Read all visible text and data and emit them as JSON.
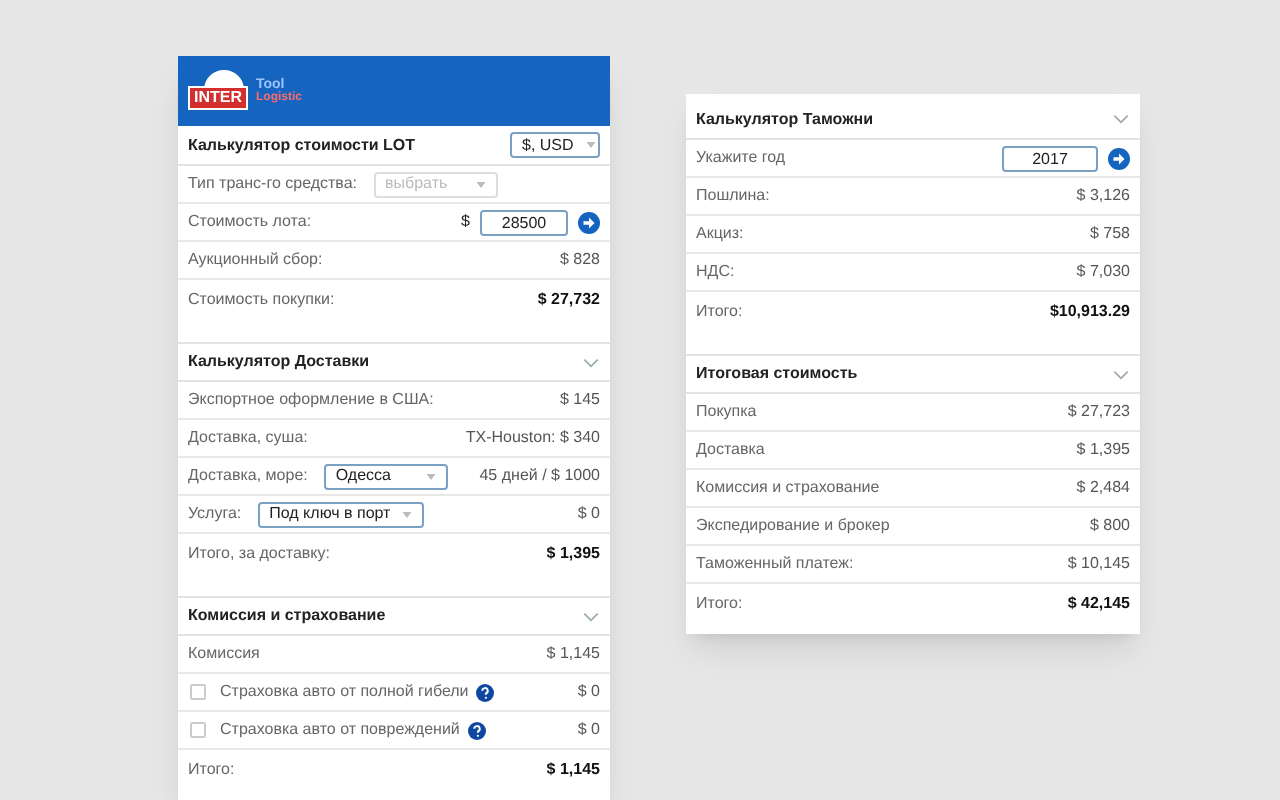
{
  "panels": [
    {
      "logo": {
        "badge": "INTER",
        "word_1": "Tool",
        "word_2": "Logistic"
      },
      "sections": [
        {
          "title": "Калькулятор стоимости LOT",
          "header_select": {
            "value": "$, USD",
            "disabled": false
          },
          "rows": [
            {
              "kind": "select",
              "label": "Тип транс-го средства:",
              "select": {
                "value": "выбрать",
                "disabled": true
              }
            },
            {
              "kind": "input",
              "label": "Стоимость лота:",
              "prefix": "$",
              "input": "28500"
            },
            {
              "kind": "text",
              "label": "Аукционный сбор:",
              "value": "$ 828"
            },
            {
              "kind": "total",
              "label": "Стоимость покупки:",
              "value": "$ 27,732"
            }
          ]
        },
        {
          "title": "Калькулятор Доставки",
          "rows": [
            {
              "kind": "text",
              "label": "Экспортное оформление в США:",
              "value": "$ 145"
            },
            {
              "kind": "text",
              "label": "Доставка, суша:",
              "value": "TX-Houston: $ 340"
            },
            {
              "kind": "select",
              "label": "Доставка, море:",
              "select": {
                "value": "Одесса",
                "disabled": false
              },
              "value": "45 дней / $ 1000"
            },
            {
              "kind": "select",
              "label": "Услуга:",
              "select": {
                "value": "Под ключ в порт",
                "disabled": false
              },
              "value": "$ 0"
            },
            {
              "kind": "total",
              "label": "Итого, за доставку:",
              "value": "$ 1,395"
            }
          ]
        },
        {
          "title": "Комиссия и страхование",
          "rows": [
            {
              "kind": "text",
              "label": "Комиссия",
              "value": "$ 1,145"
            },
            {
              "kind": "checkbox",
              "label": "Страховка авто от полной гибели",
              "checked": false,
              "value": "$ 0"
            },
            {
              "kind": "checkbox",
              "label": "Страховка авто от повреждений",
              "checked": false,
              "value": "$ 0"
            },
            {
              "kind": "total",
              "label": "Итого:",
              "value": "$ 1,145"
            }
          ]
        }
      ]
    },
    {
      "sections": [
        {
          "title": "Калькулятор Таможни",
          "rows": [
            {
              "kind": "spinner",
              "label": "Укажите год",
              "input": "2017"
            },
            {
              "kind": "text",
              "label": "Пошлина:",
              "value": "$ 3,126"
            },
            {
              "kind": "text",
              "label": "Акциз:",
              "value": "$ 758"
            },
            {
              "kind": "text",
              "label": "НДС:",
              "value": "$ 7,030"
            },
            {
              "kind": "total",
              "label": "Итого:",
              "value": "$10,913.29"
            }
          ]
        },
        {
          "title": "Итоговая стоимость",
          "rows": [
            {
              "kind": "text",
              "label": "Покупка",
              "value": "$ 27,723"
            },
            {
              "kind": "text",
              "label": "Доставка",
              "value": "$ 1,395"
            },
            {
              "kind": "text",
              "label": "Комиссия и страхование",
              "value": "$ 2,484"
            },
            {
              "kind": "text",
              "label": "Экспедирование и брокер",
              "value": "$ 800"
            },
            {
              "kind": "text",
              "label": "Таможенный платеж:",
              "value": "$ 10,145"
            },
            {
              "kind": "total",
              "label": "Итого:",
              "value": "$ 42,145"
            }
          ]
        }
      ]
    }
  ]
}
